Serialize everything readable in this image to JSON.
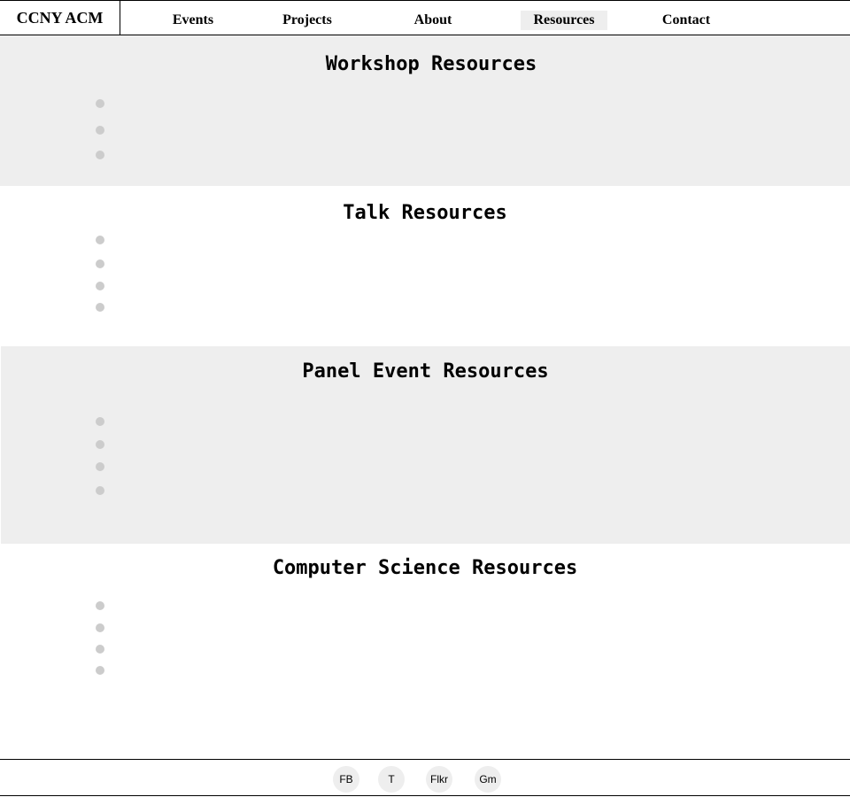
{
  "header": {
    "brand": "CCNY ACM",
    "nav": {
      "events": "Events",
      "projects": "Projects",
      "about": "About",
      "resources": "Resources",
      "contact": "Contact"
    },
    "active_nav": "Resources"
  },
  "sections": {
    "workshop": {
      "title": "Workshop Resources",
      "item_count": 3
    },
    "talk": {
      "title": "Talk Resources",
      "item_count": 4
    },
    "panel": {
      "title": "Panel Event Resources",
      "item_count": 4
    },
    "cs": {
      "title": "Computer Science Resources",
      "item_count": 4
    }
  },
  "footer": {
    "social": {
      "facebook": "FB",
      "twitter": "T",
      "flickr": "Flkr",
      "gmail": "Gm"
    }
  },
  "colors": {
    "band_gray": "#eeeeee",
    "bullet_gray": "#cccccc",
    "active_nav_bg": "#eeeeee"
  }
}
